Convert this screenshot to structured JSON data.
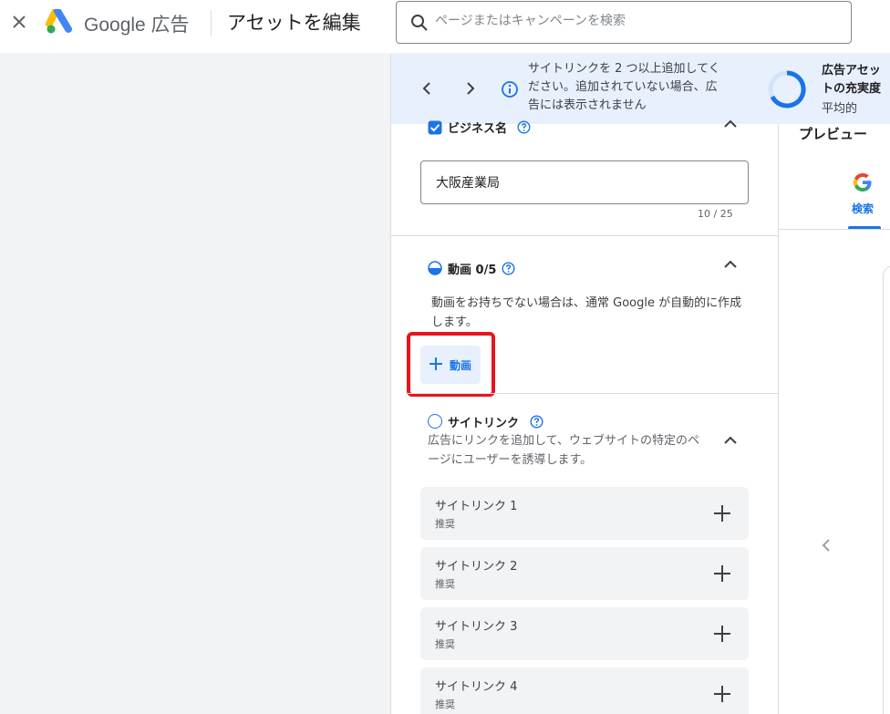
{
  "header": {
    "close_icon": "close-icon",
    "brand": "Google 広告",
    "title": "アセットを編集",
    "search": {
      "placeholder": "ページまたはキャンペーンを検索",
      "value": ""
    }
  },
  "banner": {
    "message": "サイトリンクを 2 つ以上追加してください。追加されていない場合、広告には表示されません",
    "strength": {
      "title": "広告アセットの充実度",
      "value": "平均的"
    }
  },
  "business_name": {
    "title": "ビジネス名",
    "value": "大阪産業局",
    "count": "10 / 25"
  },
  "video": {
    "title": "動画 0/5",
    "description": "動画をお持ちでない場合は、通常 Google が自動的に作成します。",
    "add_label": "動画"
  },
  "sitelinks": {
    "title": "サイトリンク",
    "description": "広告にリンクを追加して、ウェブサイトの特定のページにユーザーを誘導します。",
    "items": [
      {
        "name": "サイトリンク 1",
        "tag": "推奨"
      },
      {
        "name": "サイトリンク 2",
        "tag": "推奨"
      },
      {
        "name": "サイトリンク 3",
        "tag": "推奨"
      },
      {
        "name": "サイトリンク 4",
        "tag": "推奨"
      }
    ]
  },
  "preview": {
    "title": "プレビュー",
    "tab_search": "検索"
  },
  "colors": {
    "accent": "#1a73e8",
    "highlight": "#e8141b",
    "banner_bg": "#e8f0fe"
  }
}
